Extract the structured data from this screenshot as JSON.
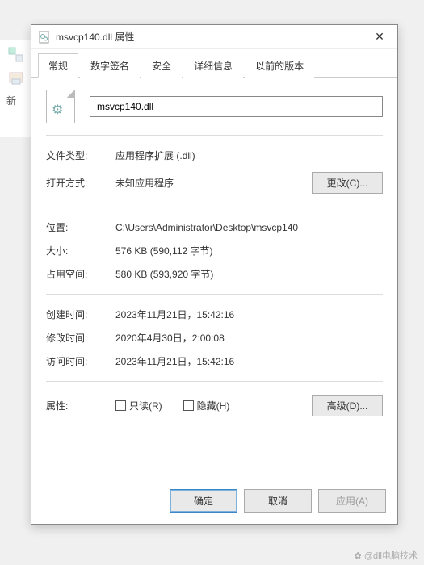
{
  "background": {
    "toolbar_item": "新"
  },
  "dialog": {
    "title": "msvcp140.dll 属性",
    "tabs": [
      "常规",
      "数字签名",
      "安全",
      "详细信息",
      "以前的版本"
    ],
    "filename": "msvcp140.dll",
    "rows": {
      "filetype_label": "文件类型:",
      "filetype_value": "应用程序扩展 (.dll)",
      "openwith_label": "打开方式:",
      "openwith_value": "未知应用程序",
      "change_btn": "更改(C)...",
      "location_label": "位置:",
      "location_value": "C:\\Users\\Administrator\\Desktop\\msvcp140",
      "size_label": "大小:",
      "size_value": "576 KB (590,112 字节)",
      "ondisk_label": "占用空间:",
      "ondisk_value": "580 KB (593,920 字节)",
      "created_label": "创建时间:",
      "created_value": "2023年11月21日，15:42:16",
      "modified_label": "修改时间:",
      "modified_value": "2020年4月30日，2:00:08",
      "accessed_label": "访问时间:",
      "accessed_value": "2023年11月21日，15:42:16",
      "attr_label": "属性:",
      "readonly": "只读(R)",
      "hidden": "隐藏(H)",
      "advanced_btn": "高级(D)..."
    },
    "footer": {
      "ok": "确定",
      "cancel": "取消",
      "apply": "应用(A)"
    }
  },
  "watermark": "@dll电脑技术"
}
